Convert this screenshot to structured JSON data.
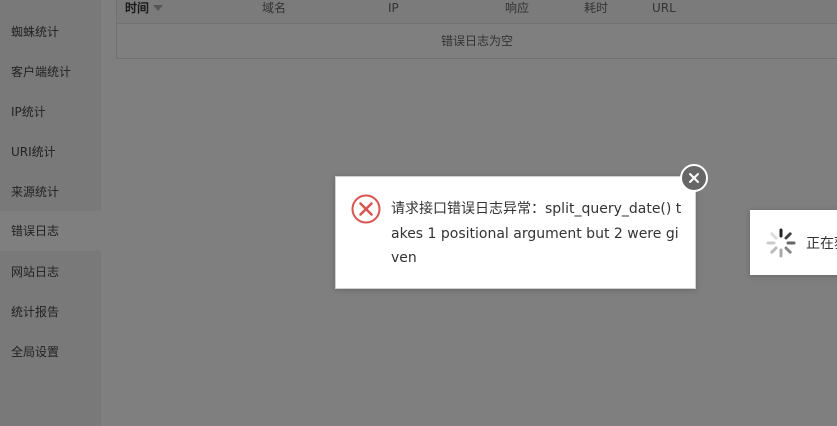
{
  "sidebar": {
    "items": [
      {
        "label": "蜘蛛统计"
      },
      {
        "label": "客户端统计"
      },
      {
        "label": "IP统计"
      },
      {
        "label": "URI统计"
      },
      {
        "label": "来源统计"
      },
      {
        "label": "错误日志",
        "active": true
      },
      {
        "label": "网站日志"
      },
      {
        "label": "统计报告"
      },
      {
        "label": "全局设置"
      }
    ]
  },
  "table": {
    "columns": [
      "时间",
      "域名",
      "IP",
      "响应",
      "耗时",
      "URL"
    ],
    "empty_text": "错误日志为空"
  },
  "error_toast": {
    "message": "请求接口错误日志异常：split_query_date() takes 1 positional argument but 2 were given",
    "icon": "error-circle-x-icon",
    "icon_color": "#d9534f"
  },
  "loading": {
    "text": "正在获取"
  },
  "colors": {
    "overlay": "rgba(0,0,0,0.5)"
  }
}
